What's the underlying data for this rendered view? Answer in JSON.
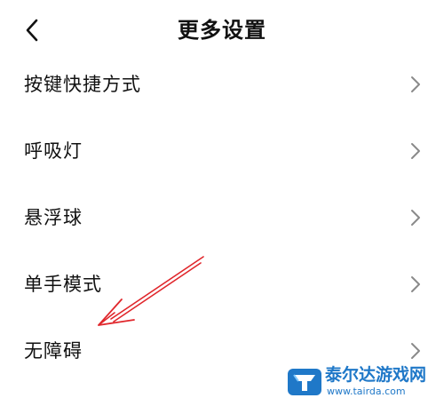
{
  "header": {
    "title": "更多设置",
    "back_icon": "chevron-left-icon"
  },
  "menu": {
    "items": [
      {
        "label": "按键快捷方式",
        "icon": "chevron-right-icon"
      },
      {
        "label": "呼吸灯",
        "icon": "chevron-right-icon"
      },
      {
        "label": "悬浮球",
        "icon": "chevron-right-icon"
      },
      {
        "label": "单手模式",
        "icon": "chevron-right-icon"
      },
      {
        "label": "无障碍",
        "icon": "chevron-right-icon"
      }
    ]
  },
  "annotation": {
    "type": "red-arrow",
    "points_to": "无障碍",
    "color": "#e0262b"
  },
  "watermark": {
    "name": "泰尔达游戏网",
    "url": "www.tairda.com",
    "color": "#1f78c8"
  },
  "colors": {
    "text": "#111111",
    "chevron": "#8a8a8a",
    "background": "#ffffff"
  }
}
